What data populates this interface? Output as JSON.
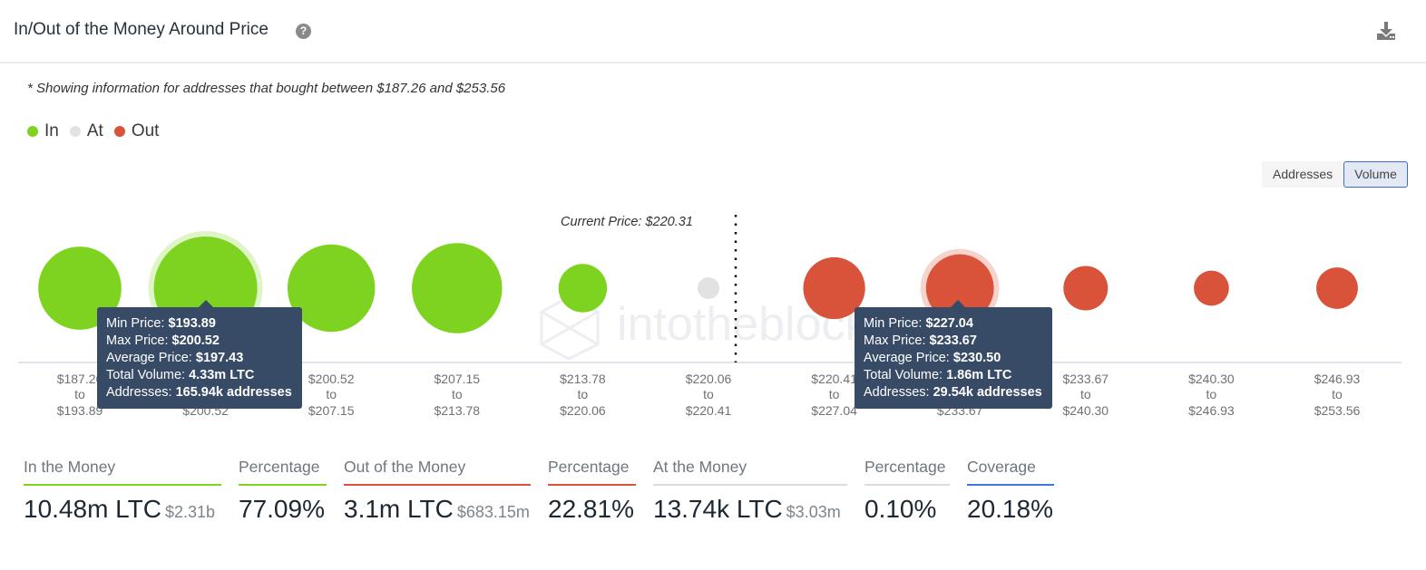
{
  "header": {
    "title": "In/Out of the Money Around Price",
    "help_icon": "question-circle-icon",
    "download_icon": "download-icon"
  },
  "note": "* Showing information for addresses that bought between $187.26 and $253.56",
  "legend": [
    {
      "label": "In",
      "color": "#7ed321"
    },
    {
      "label": "At",
      "color": "#e2e2e2"
    },
    {
      "label": "Out",
      "color": "#d9523a"
    }
  ],
  "toggle": {
    "options": [
      "Addresses",
      "Volume"
    ],
    "selected": "Volume"
  },
  "colors": {
    "in": "#7ed321",
    "at": "#e2e2e2",
    "out": "#d9523a",
    "tooltip_bg": "#374a66",
    "coverage": "#3a78e0",
    "at_line": "#dcdcdc"
  },
  "chart_data": {
    "type": "bubble",
    "title": "In/Out of the Money Around Price",
    "metric": "Volume (LTC)",
    "current_price_label": "Current Price: $220.31",
    "current_price": 220.31,
    "categories": [
      {
        "from": "$187.26",
        "to": "$193.89",
        "status": "in",
        "volume_m": 2.8
      },
      {
        "from": "$193.89",
        "to": "$200.52",
        "status": "in",
        "volume_m": 4.33
      },
      {
        "from": "$200.52",
        "to": "$207.15",
        "status": "in",
        "volume_m": 3.1
      },
      {
        "from": "$207.15",
        "to": "$213.78",
        "status": "in",
        "volume_m": 3.3
      },
      {
        "from": "$213.78",
        "to": "$220.06",
        "status": "in",
        "volume_m": 0.95
      },
      {
        "from": "$220.06",
        "to": "$220.41",
        "status": "at",
        "volume_m": 0.0137
      },
      {
        "from": "$220.41",
        "to": "$227.04",
        "status": "out",
        "volume_m": 1.55
      },
      {
        "from": "$227.04",
        "to": "$233.67",
        "status": "out",
        "volume_m": 1.86
      },
      {
        "from": "$233.67",
        "to": "$240.30",
        "status": "out",
        "volume_m": 0.8
      },
      {
        "from": "$240.30",
        "to": "$246.93",
        "status": "out",
        "volume_m": 0.5
      },
      {
        "from": "$246.93",
        "to": "$253.56",
        "status": "out",
        "volume_m": 0.7
      }
    ],
    "to_word": "to",
    "watermark": "intotheblock"
  },
  "tooltips": [
    {
      "rows": [
        {
          "label": "Min Price: ",
          "value": "$193.89"
        },
        {
          "label": "Max Price: ",
          "value": "$200.52"
        },
        {
          "label": "Average Price: ",
          "value": "$197.43"
        },
        {
          "label": "Total Volume: ",
          "value": "4.33m LTC"
        },
        {
          "label": "Addresses: ",
          "value": "165.94k addresses"
        }
      ]
    },
    {
      "rows": [
        {
          "label": "Min Price: ",
          "value": "$227.04"
        },
        {
          "label": "Max Price: ",
          "value": "$233.67"
        },
        {
          "label": "Average Price: ",
          "value": "$230.50"
        },
        {
          "label": "Total Volume: ",
          "value": "1.86m LTC"
        },
        {
          "label": "Addresses: ",
          "value": "29.54k addresses"
        }
      ]
    }
  ],
  "stats": [
    {
      "label": "In the Money",
      "value": "10.48m LTC",
      "sub": "$2.31b",
      "color": "#7ed321"
    },
    {
      "label": "Percentage",
      "value": "77.09%",
      "sub": "",
      "color": "#7ed321"
    },
    {
      "label": "Out of the Money",
      "value": "3.1m LTC",
      "sub": "$683.15m",
      "color": "#d9523a"
    },
    {
      "label": "Percentage",
      "value": "22.81%",
      "sub": "",
      "color": "#d9523a"
    },
    {
      "label": "At the Money",
      "value": "13.74k LTC",
      "sub": "$3.03m",
      "color": "#dcdcdc"
    },
    {
      "label": "Percentage",
      "value": "0.10%",
      "sub": "",
      "color": "#dcdcdc"
    },
    {
      "label": "Coverage",
      "value": "20.18%",
      "sub": "",
      "color": "#3a78e0"
    }
  ]
}
